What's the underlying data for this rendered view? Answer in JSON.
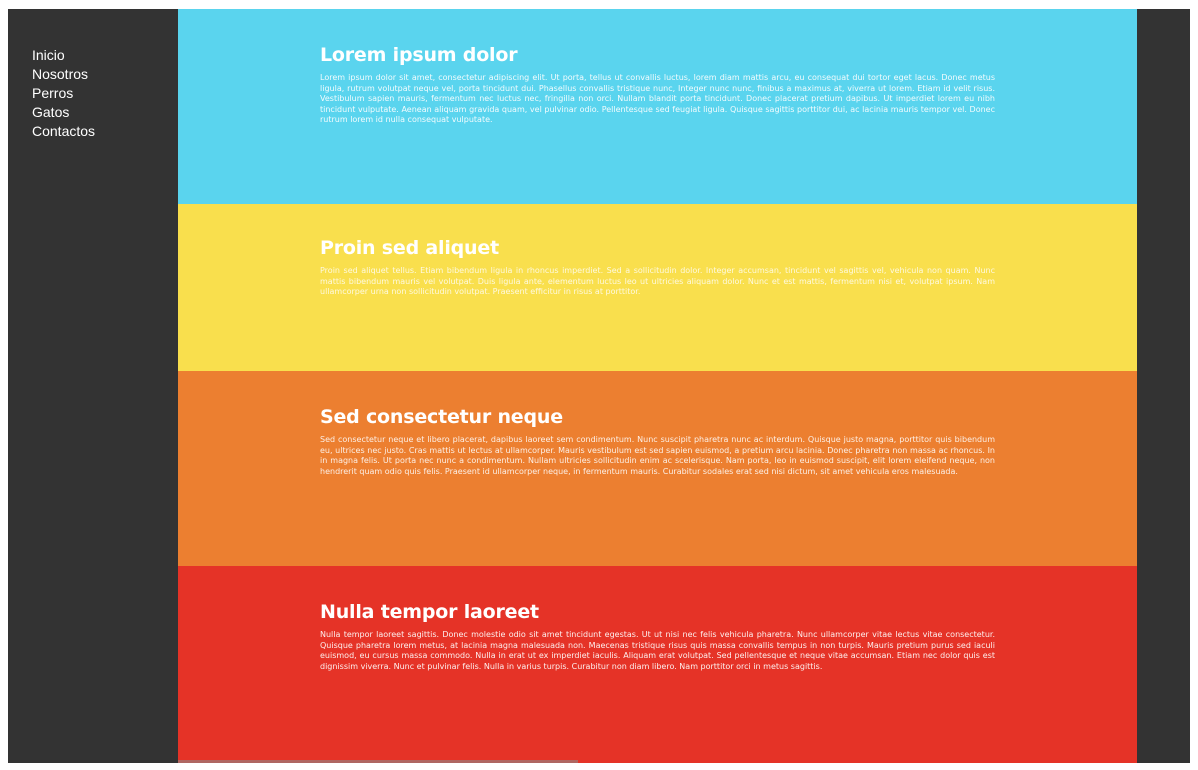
{
  "nav": {
    "items": [
      {
        "label": "Inicio"
      },
      {
        "label": "Nosotros"
      },
      {
        "label": "Perros"
      },
      {
        "label": "Gatos"
      },
      {
        "label": "Contactos"
      }
    ]
  },
  "sections": [
    {
      "title": "Lorem ipsum dolor",
      "body": "Lorem ipsum dolor sit amet, consectetur adipiscing elit. Ut porta, tellus ut convallis luctus, lorem diam mattis arcu, eu consequat dui tortor eget lacus. Donec metus ligula, rutrum volutpat neque vel, porta tincidunt dui. Phasellus convallis tristique nunc, Integer nunc nunc, finibus a maximus at, viverra ut lorem. Etiam id velit risus. Vestibulum sapien mauris, fermentum nec luctus nec, fringilla non orci. Nullam blandit porta tincidunt. Donec placerat pretium dapibus. Ut imperdiet lorem eu nibh tincidunt vulputate. Aenean aliquam gravida quam, vel pulvinar odio. Pellentesque sed feugiat ligula. Quisque sagittis porttitor dui, ac lacinia mauris tempor vel. Donec rutrum lorem id nulla consequat vulputate.",
      "color": "#5ad4ee"
    },
    {
      "title": "Proin sed aliquet",
      "body": "Proin sed aliquet tellus. Etiam bibendum ligula in rhoncus imperdiet. Sed a sollicitudin dolor. Integer accumsan, tincidunt vel sagittis vel, vehicula non quam. Nunc mattis bibendum mauris vel volutpat. Duis ligula ante, elementum luctus leo ut ultricies aliquam dolor. Nunc et est mattis, fermentum nisi et, volutpat ipsum. Nam ullamcorper urna non sollicitudin volutpat. Praesent efficitur in risus at porttitor.",
      "color": "#f9df4d"
    },
    {
      "title": "Sed consectetur neque",
      "body": "Sed consectetur neque et libero placerat, dapibus laoreet sem condimentum. Nunc suscipit pharetra nunc ac interdum. Quisque justo magna, porttitor quis bibendum eu, ultrices nec justo. Cras mattis ut lectus at ullamcorper. Mauris vestibulum est sed sapien euismod, a pretium arcu lacinia. Donec pharetra non massa ac rhoncus. In in magna felis. Ut porta nec nunc a condimentum. Nullam ultricies sollicitudin enim ac scelerisque. Nam porta, leo in euismod suscipit, elit lorem eleifend neque, non hendrerit quam odio quis felis. Praesent id ullamcorper neque, in fermentum mauris. Curabitur sodales erat sed nisi dictum, sit amet vehicula eros malesuada.",
      "color": "#ec7f30"
    },
    {
      "title": "Nulla tempor laoreet",
      "body": "Nulla tempor laoreet sagittis. Donec molestie odio sit amet tincidunt egestas. Ut ut nisi nec felis vehicula pharetra. Nunc ullamcorper vitae lectus vitae consectetur. Quisque pharetra lorem metus, at lacinia magna malesuada non. Maecenas tristique risus quis massa convallis tempus in non turpis. Mauris pretium purus sed iaculi euismod, eu cursus massa commodo. Nulla in erat ut ex imperdiet iaculis. Aliquam erat volutpat. Sed pellentesque et neque vitae accumsan. Etiam nec dolor quis est dignissim viverra. Nunc et pulvinar felis. Nulla in varius turpis. Curabitur non diam libero. Nam porttitor orci in metus sagittis.",
      "color": "#e53327"
    }
  ],
  "colors": {
    "sidebar": "#333333",
    "text": "#ffffff"
  }
}
